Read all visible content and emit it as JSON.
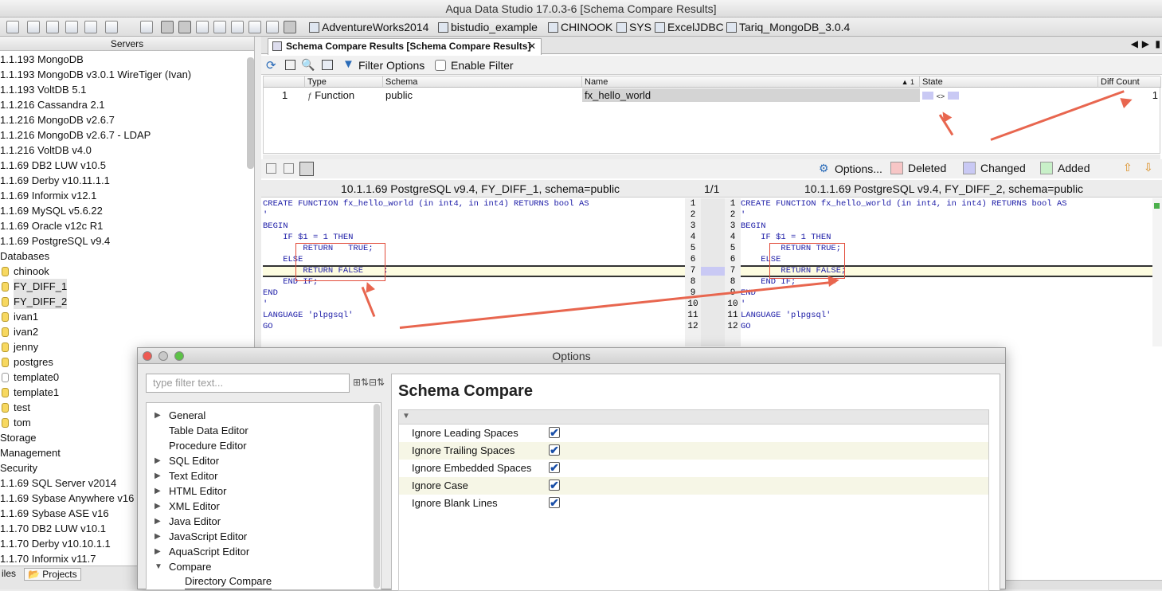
{
  "window": {
    "title": "Aqua Data Studio 17.0.3-6 [Schema Compare Results]"
  },
  "toolbar": {
    "connections": [
      "AdventureWorks2014",
      "bistudio_example",
      "CHINOOK",
      "SYS",
      "ExcelJDBC",
      "Tariq_MongoDB_3.0.4"
    ]
  },
  "servers": {
    "header": "Servers",
    "items": [
      "1.1.193 MongoDB",
      "1.1.193 MongoDB v3.0.1 WireTiger (Ivan)",
      "1.1.193 VoltDB 5.1",
      "1.1.216 Cassandra 2.1",
      "1.1.216 MongoDB v2.6.7",
      "1.1.216 MongoDB v2.6.7 - LDAP",
      "1.1.216 VoltDB  v4.0",
      "1.1.69 DB2 LUW v10.5",
      "1.1.69 Derby v10.11.1.1",
      "1.1.69 Informix v12.1",
      "1.1.69 MySQL v5.6.22",
      "1.1.69 Oracle  v12c R1",
      "1.1.69 PostgreSQL  v9.4",
      "Databases"
    ],
    "databases": [
      "chinook",
      "FY_DIFF_1",
      "FY_DIFF_2",
      "ivan1",
      "ivan2",
      "jenny",
      "postgres",
      "template0",
      "template1",
      "test",
      "tom"
    ],
    "after": [
      "Storage",
      "Management",
      "Security",
      "1.1.69 SQL Server v2014",
      "1.1.69 Sybase Anywhere v16",
      "1.1.69 Sybase ASE v16",
      "1.1.70 DB2 LUW v10.1",
      "1.1.70 Derby v10.10.1.1",
      "1.1.70 Informix v11.7"
    ],
    "bottom_tabs": [
      "iles",
      "Projects"
    ]
  },
  "tab": {
    "label": "Schema Compare Results [Schema Compare Results]",
    "close": "✕"
  },
  "subtoolbar": {
    "filter_options": "Filter Options",
    "enable_filter": "Enable Filter"
  },
  "grid": {
    "headers": [
      "Type",
      "Schema",
      "Name",
      "State",
      "Diff Count"
    ],
    "sort_marker": "▲ 1",
    "row": {
      "num": "1",
      "type": "Function",
      "schema": "public",
      "name": "fx_hello_world",
      "state": "<>",
      "diff_count": "1"
    }
  },
  "difftool": {
    "options": "Options...",
    "deleted": "Deleted",
    "changed": "Changed",
    "added": "Added"
  },
  "diff": {
    "left_title": "10.1.1.69 PostgreSQL  v9.4, FY_DIFF_1,  schema=public",
    "center": "1/1",
    "right_title": "10.1.1.69 PostgreSQL  v9.4, FY_DIFF_2,  schema=public",
    "left_lines": [
      "CREATE FUNCTION fx_hello_world (in int4, in int4) RETURNS bool AS",
      "'",
      "BEGIN",
      "    IF $1 = 1 THEN",
      "        RETURN   TRUE;",
      "    ELSE",
      "        RETURN FALSE    ;",
      "    END IF;",
      "END",
      "'",
      "LANGUAGE 'plpgsql'",
      "GO"
    ],
    "right_lines": [
      "CREATE FUNCTION fx_hello_world (in int4, in int4) RETURNS bool AS",
      "'",
      "BEGIN",
      "    IF $1 = 1 THEN",
      "        RETURN TRUE;",
      "    ELSE",
      "        RETURN FALSE;",
      "    END IF;",
      "END",
      "'",
      "LANGUAGE 'plpgsql'",
      "GO"
    ],
    "line_numbers": [
      "1",
      "2",
      "3",
      "4",
      "5",
      "6",
      "7",
      "8",
      "9",
      "10",
      "11",
      "12"
    ]
  },
  "dialog": {
    "title": "Options",
    "filter_placeholder": "type filter text...",
    "tree": [
      {
        "label": "General",
        "arrow": "▶"
      },
      {
        "label": "Table Data Editor",
        "arrow": ""
      },
      {
        "label": "Procedure Editor",
        "arrow": ""
      },
      {
        "label": "SQL Editor",
        "arrow": "▶"
      },
      {
        "label": "Text Editor",
        "arrow": "▶"
      },
      {
        "label": "HTML Editor",
        "arrow": "▶"
      },
      {
        "label": "XML Editor",
        "arrow": "▶"
      },
      {
        "label": "Java Editor",
        "arrow": "▶"
      },
      {
        "label": "JavaScript Editor",
        "arrow": "▶"
      },
      {
        "label": "AquaScript Editor",
        "arrow": "▶"
      },
      {
        "label": "Compare",
        "arrow": "▼"
      },
      {
        "label": "Directory Compare",
        "arrow": ""
      }
    ],
    "section_title": "Schema Compare",
    "options": [
      {
        "label": "Ignore Leading Spaces",
        "checked": "✔"
      },
      {
        "label": "Ignore Trailing Spaces",
        "checked": "✔"
      },
      {
        "label": "Ignore Embedded Spaces",
        "checked": "✔"
      },
      {
        "label": "Ignore Case",
        "checked": "✔"
      },
      {
        "label": "Ignore Blank Lines",
        "checked": "✔"
      }
    ]
  },
  "colors": {
    "deleted": "#f7c6c6",
    "changed": "#c9c9f4",
    "added": "#c8f0c8",
    "annotation": "#e8664f"
  }
}
